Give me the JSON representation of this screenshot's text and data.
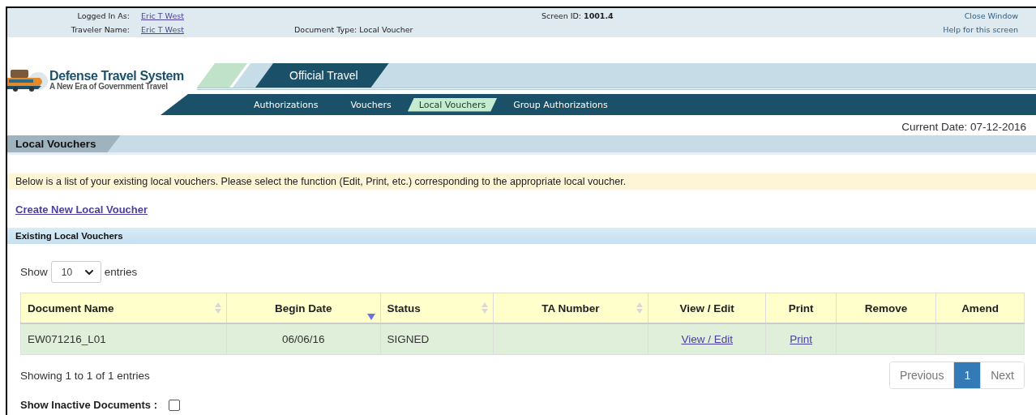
{
  "top_bar": {
    "logged_in_label": "Logged In As:",
    "logged_in_user": "Eric T West",
    "traveler_label": "Traveler Name:",
    "traveler_name": "Eric T West",
    "screen_id_label": "Screen ID:",
    "screen_id": "1001.4",
    "document_type": "Document Type: Local Voucher",
    "links": [
      "Close Window",
      "Help for this screen"
    ]
  },
  "brand": {
    "title": "Defense Travel System",
    "subtitle": "A New Era of Government Travel"
  },
  "main_tab": "Official Travel",
  "nav": [
    {
      "label": "Authorizations",
      "selected": false
    },
    {
      "label": "Vouchers",
      "selected": false
    },
    {
      "label": "Local Vouchers",
      "selected": true
    },
    {
      "label": "Group Authorizations",
      "selected": false
    }
  ],
  "current_date": "Current Date: 07-12-2016",
  "section_title": "Local Vouchers",
  "info": "Below is a list of your existing local vouchers. Please select the function (Edit, Print, etc.) corresponding to the appropriate local voucher.",
  "create_link": "Create New Local Voucher",
  "table_title": "Existing Local Vouchers",
  "length_menu": {
    "before": "Show",
    "value": "10",
    "after": "entries"
  },
  "table": {
    "columns": [
      {
        "label": "Document Name",
        "sortable": true,
        "sorted_descending": false
      },
      {
        "label": "Begin Date",
        "sortable": true,
        "sorted_descending": true
      },
      {
        "label": "Status",
        "sortable": true,
        "sorted_descending": false
      },
      {
        "label": "TA Number",
        "sortable": true,
        "sorted_descending": false
      },
      {
        "label": "View / Edit",
        "sortable": false
      },
      {
        "label": "Print",
        "sortable": false
      },
      {
        "label": "Remove",
        "sortable": false
      },
      {
        "label": "Amend",
        "sortable": false
      }
    ],
    "rows": [
      {
        "cells": [
          {
            "kind": "text",
            "text": "EW071216_L01"
          },
          {
            "kind": "text",
            "text": "06/06/16"
          },
          {
            "kind": "text",
            "text": "SIGNED"
          },
          null,
          {
            "kind": "link",
            "text": "View / Edit"
          },
          {
            "kind": "link",
            "text": "Print"
          },
          null,
          null
        ]
      }
    ]
  },
  "info_count": "Showing 1 to 1 of 1 entries",
  "pagination": [
    {
      "label": "Previous",
      "selected": false
    },
    {
      "label": "1",
      "selected": true
    },
    {
      "label": "Next",
      "selected": false
    }
  ],
  "inactive": {
    "label": "Show Inactive Documents :",
    "checked": false
  }
}
